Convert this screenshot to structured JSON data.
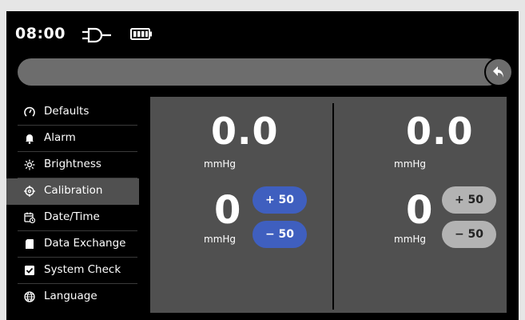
{
  "status": {
    "time": "08:00",
    "plug_icon": "power-plug-icon",
    "battery_icon": "battery-full-icon"
  },
  "nav": {
    "back_icon": "back-arrow-icon"
  },
  "menu": {
    "items": [
      {
        "label": "Defaults",
        "icon": "gauge-icon"
      },
      {
        "label": "Alarm",
        "icon": "bell-icon"
      },
      {
        "label": "Brightness",
        "icon": "sun-icon"
      },
      {
        "label": "Calibration",
        "icon": "crosshair-icon",
        "active": true
      },
      {
        "label": "Date/Time",
        "icon": "calendar-clock-icon"
      },
      {
        "label": "Data Exchange",
        "icon": "sd-card-icon"
      },
      {
        "label": "System Check",
        "icon": "checkbox-icon"
      },
      {
        "label": "Language",
        "icon": "globe-icon"
      }
    ]
  },
  "calibration": {
    "left": {
      "reading": "0.0",
      "reading_unit": "mmHg",
      "offset": "0",
      "offset_unit": "mmHg",
      "plus_label": "+ 50",
      "minus_label": "− 50"
    },
    "right": {
      "reading": "0.0",
      "reading_unit": "mmHg",
      "offset": "0",
      "offset_unit": "mmHg",
      "plus_label": "+ 50",
      "minus_label": "− 50"
    }
  },
  "colors": {
    "accent_blue": "#3f5fbf",
    "disabled_gray": "#b3b3b3",
    "panel": "#505050"
  }
}
